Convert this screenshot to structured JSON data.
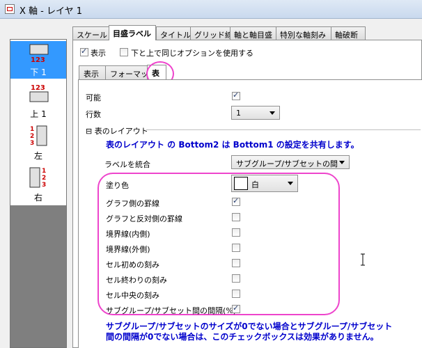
{
  "window": {
    "title": "X 軸 - レイヤ 1"
  },
  "left_list": {
    "items": [
      {
        "label": "下 1",
        "icon": "axis-bottom-icon",
        "ticks": "123",
        "selected": true
      },
      {
        "label": "上 1",
        "icon": "axis-top-icon",
        "ticks": "123",
        "selected": false
      },
      {
        "label": "左",
        "icon": "axis-left-icon",
        "ticks": "123",
        "selected": false
      },
      {
        "label": "右",
        "icon": "axis-right-icon",
        "ticks": "123",
        "selected": false
      }
    ]
  },
  "top_tabs": [
    "スケール",
    "目盛ラベル",
    "タイトル",
    "グリッド線",
    "軸と軸目盛",
    "特別な軸刻み",
    "軸破断"
  ],
  "top_options": {
    "show_label": "表示",
    "show_checked": true,
    "same_options_label": "下と上で同じオプションを使用する",
    "same_options_checked": false
  },
  "sub_tabs": [
    "表示",
    "フォーマット",
    "表"
  ],
  "props": {
    "enabled_label": "可能",
    "enabled_checked": true,
    "rows_label": "行数",
    "rows_value": "1",
    "layout_section": "表のレイアウト",
    "layout_toggle": "⊟",
    "note1": "表のレイアウト の Bottom2 は Bottom1 の設定を共有します。",
    "merge_label": "ラベルを統合",
    "merge_value": "サブグループ/サブセットの間",
    "fill_label": "塗り色",
    "fill_value": "白",
    "fill_color": "#ffffff",
    "rows": [
      {
        "label": "グラフ側の罫線",
        "checked": true
      },
      {
        "label": "グラフと反対側の罫線",
        "checked": false
      },
      {
        "label": "境界線(内側)",
        "checked": false
      },
      {
        "label": "境界線(外側)",
        "checked": false
      },
      {
        "label": "セル初めの刻み",
        "checked": false
      },
      {
        "label": "セル終わりの刻み",
        "checked": false
      },
      {
        "label": "セル中央の刻み",
        "checked": false
      },
      {
        "label": "サブグループ/サブセット間の間隔(%)",
        "checked": true
      }
    ],
    "note2_line1": "サブグループ/サブセットのサイズが0でない場合とサブグループ/サブセット",
    "note2_line2": "間の間隔が0でない場合は、このチェックボックスは効果がありません。"
  },
  "colors": {
    "accent": "#3399ff",
    "highlight": "#ee44cc",
    "note": "#0000cc",
    "tick_red": "#cc0000"
  }
}
